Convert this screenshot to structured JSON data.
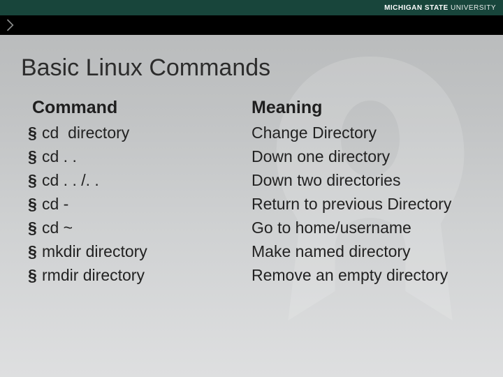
{
  "brand": {
    "strong": "MICHIGAN STATE",
    "light": " UNIVERSITY"
  },
  "title": "Basic Linux Commands",
  "headers": {
    "command": "Command",
    "meaning": "Meaning"
  },
  "rows": [
    {
      "command": "cd  directory",
      "meaning": "Change Directory"
    },
    {
      "command": "cd . .",
      "meaning": "Down one directory"
    },
    {
      "command": "cd . . /. .",
      "meaning": "Down two directories"
    },
    {
      "command": "cd -",
      "meaning": "Return to previous Directory"
    },
    {
      "command": "cd ~",
      "meaning": "Go to home/username"
    },
    {
      "command": "mkdir directory",
      "meaning": "Make named directory"
    },
    {
      "command": "rmdir directory",
      "meaning": "Remove an empty directory"
    }
  ],
  "chart_data": {
    "type": "table",
    "title": "Basic Linux Commands",
    "columns": [
      "Command",
      "Meaning"
    ],
    "rows": [
      [
        "cd  directory",
        "Change Directory"
      ],
      [
        "cd . .",
        "Down one directory"
      ],
      [
        "cd . . /. .",
        "Down two directories"
      ],
      [
        "cd -",
        "Return to previous Directory"
      ],
      [
        "cd ~",
        "Go to home/username"
      ],
      [
        "mkdir directory",
        "Make named directory"
      ],
      [
        "rmdir directory",
        "Remove an empty directory"
      ]
    ]
  }
}
